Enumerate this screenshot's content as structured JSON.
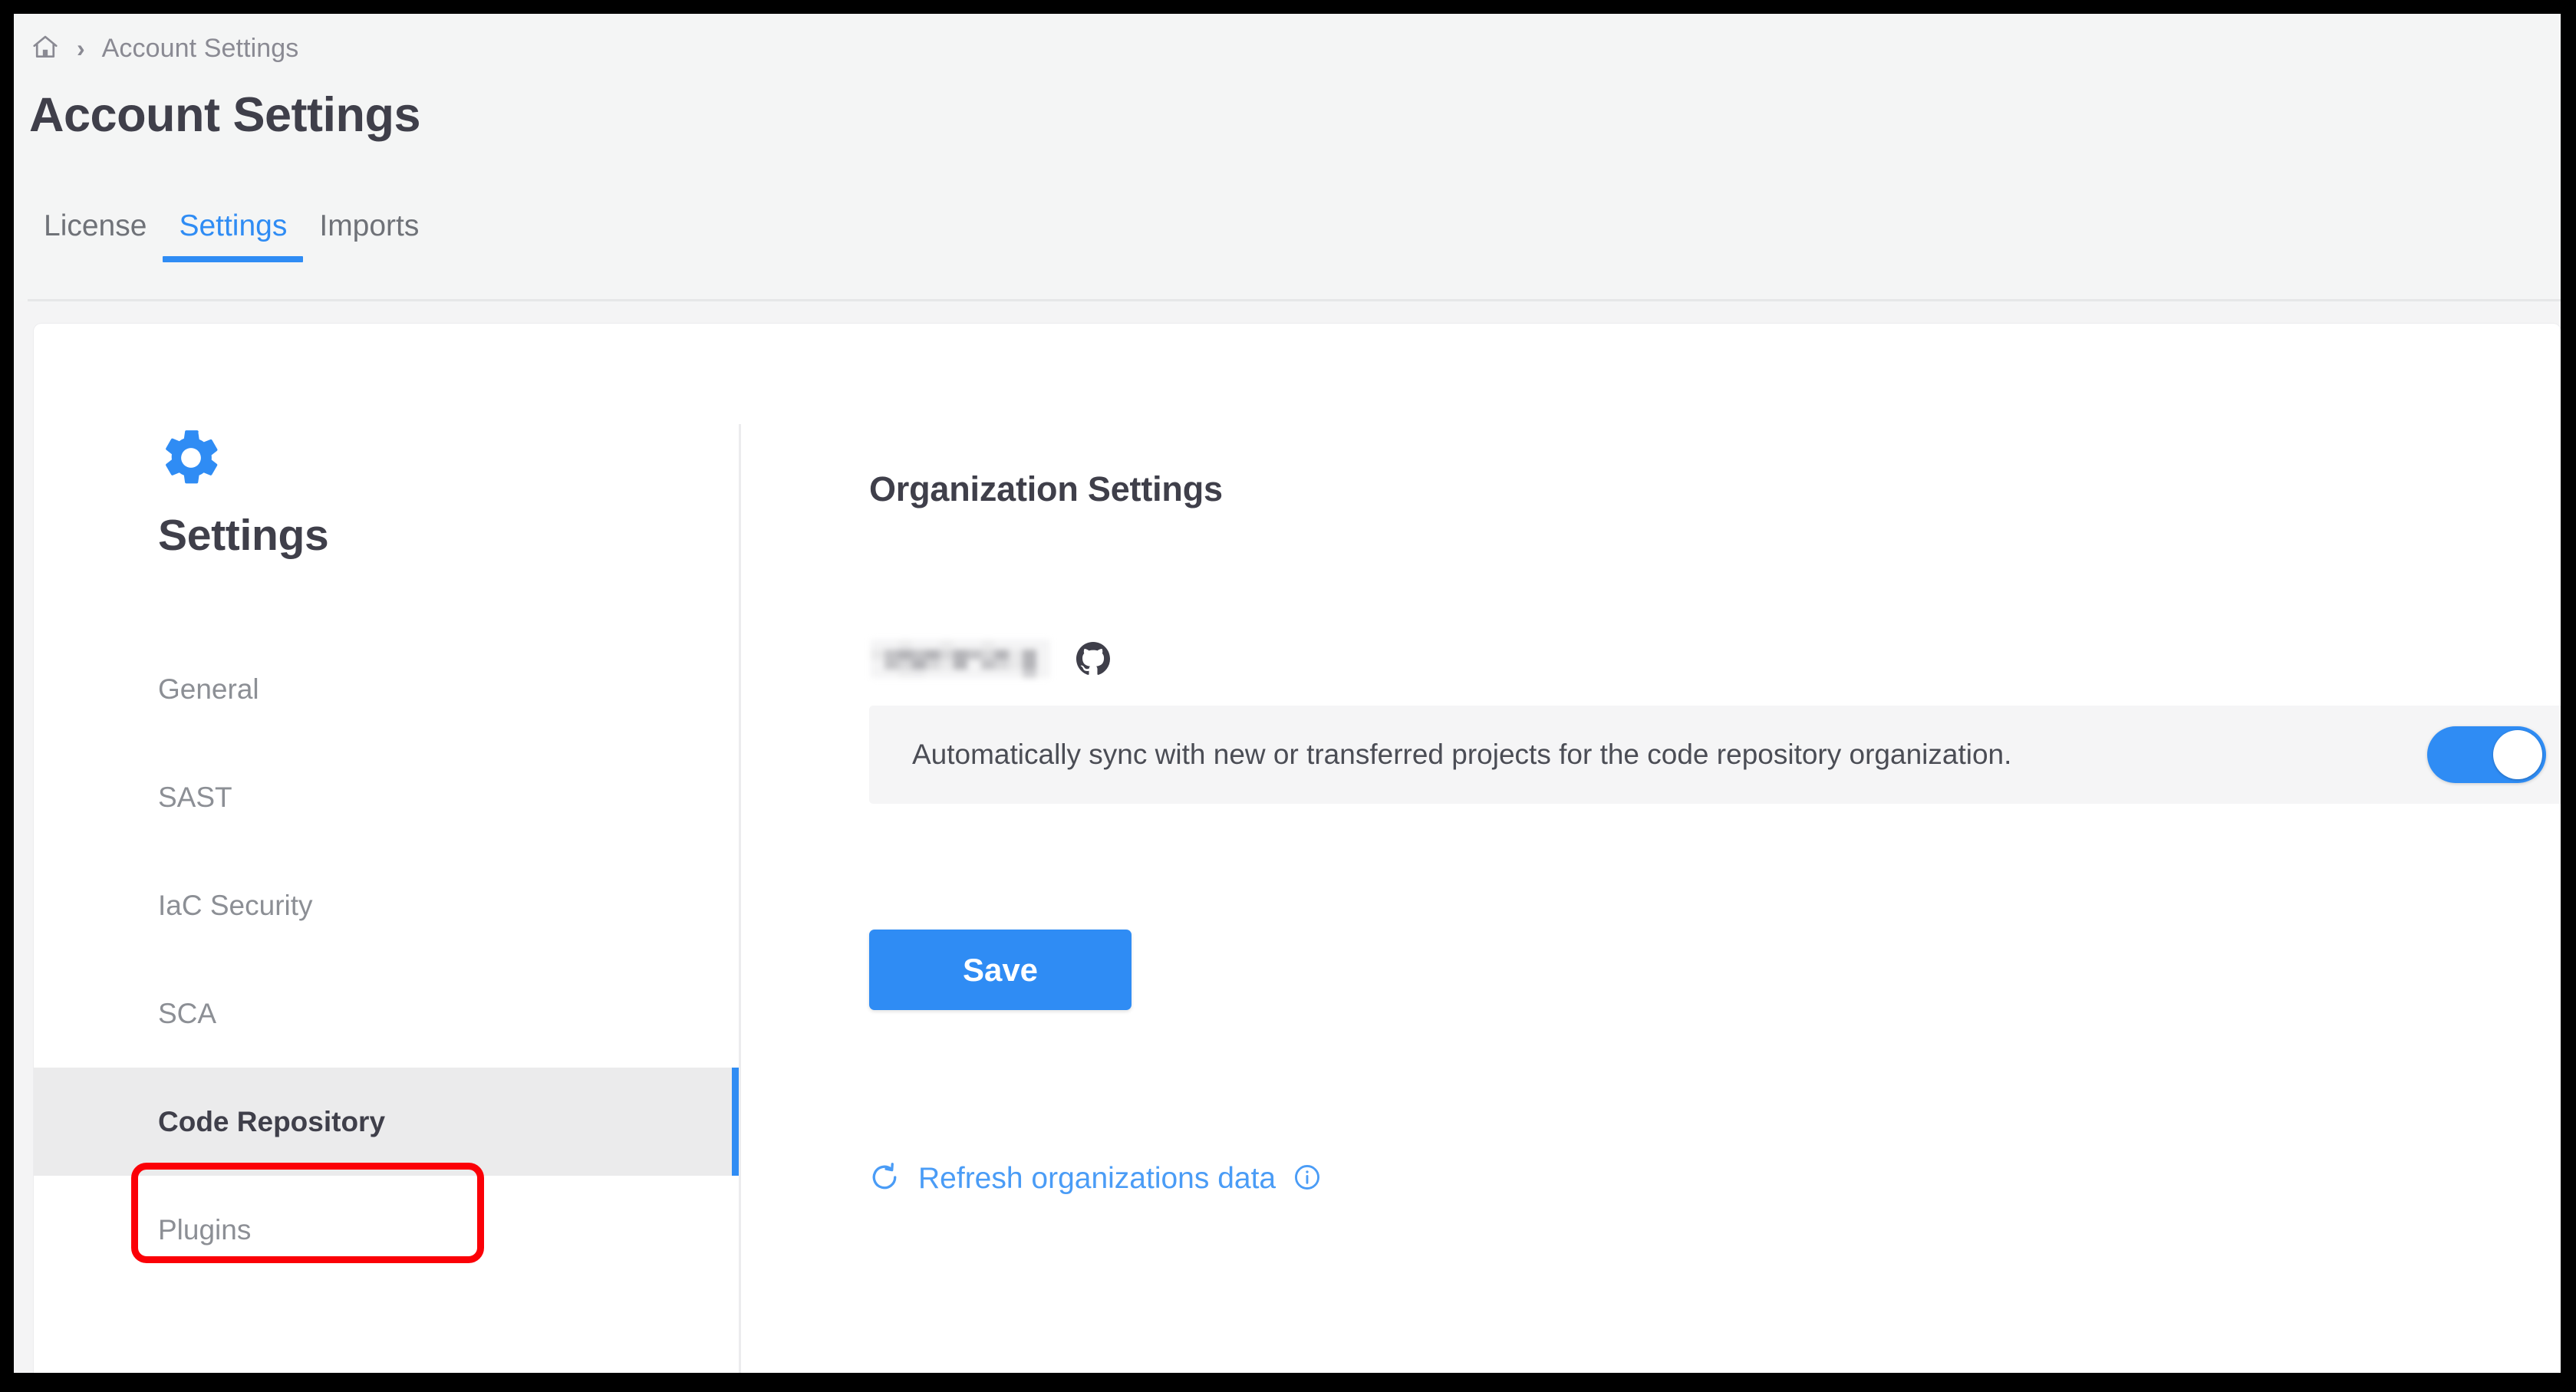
{
  "window": {
    "frame_color": "#000000",
    "page_background": "#f4f5f5",
    "card_background": "#ffffff"
  },
  "theme": {
    "accent_blue": "#2f8cf4",
    "link_blue": "#4a9cf6",
    "annotation_red": "#fb0007",
    "text_dark": "#3f3f4a",
    "text_muted": "#8c8f95",
    "selected_row_bg": "#ebebec",
    "panel_row_bg": "#f5f5f6"
  },
  "breadcrumb": {
    "home_icon": "home-icon",
    "separator_icon": "chevron-right-icon",
    "current": "Account Settings"
  },
  "header": {
    "title": "Account Settings"
  },
  "tabs": {
    "items": [
      {
        "label": "License",
        "active": false
      },
      {
        "label": "Settings",
        "active": true
      },
      {
        "label": "Imports",
        "active": false
      }
    ]
  },
  "settings_nav": {
    "icon": "gear-icon",
    "heading": "Settings",
    "items": [
      {
        "label": "General",
        "selected": false
      },
      {
        "label": "SAST",
        "selected": false
      },
      {
        "label": "IaC Security",
        "selected": false
      },
      {
        "label": "SCA",
        "selected": false
      },
      {
        "label": "Code Repository",
        "selected": true
      },
      {
        "label": "Plugins",
        "selected": false
      }
    ]
  },
  "annotation": {
    "target": "Code Repository",
    "shape": "rounded-rectangle",
    "color": "#fb0007"
  },
  "organization_settings": {
    "heading": "Organization Settings",
    "org_name": "",
    "org_name_state": "redacted",
    "provider_icon": "github-icon",
    "sync_setting": {
      "label": "Automatically sync with new or transferred projects for the code repository organization.",
      "toggle_state": "on",
      "toggle_icon": "toggle-switch-on"
    },
    "save_label": "Save",
    "refresh": {
      "icon": "refresh-icon",
      "label": "Refresh organizations data",
      "info_icon": "info-icon"
    }
  }
}
